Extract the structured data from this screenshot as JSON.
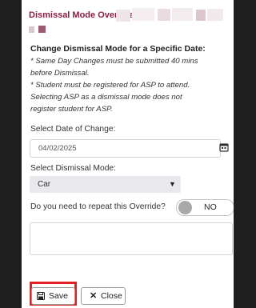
{
  "dialog": {
    "title": "Dismissal Mode Override"
  },
  "instructions": {
    "heading": "Change Dismissal Mode for a Specific Date:",
    "lines": [
      "* Same Day Changes must be submitted 40 mins",
      "before Dismissal.",
      "* Student must be registered for ASP to attend.",
      "Selecting ASP as a dismissal mode does not",
      "register student for ASP."
    ]
  },
  "date_field": {
    "label": "Select Date of Change:",
    "value": "04/02/2025",
    "icon": "calendar-icon"
  },
  "mode_field": {
    "label": "Select Dismissal Mode:",
    "value": "Car"
  },
  "repeat": {
    "question": "Do you need to repeat this Override?",
    "toggle_value": "NO"
  },
  "buttons": {
    "save": "Save",
    "close": "Close"
  },
  "colors": {
    "title": "#8b1d43",
    "highlight": "#e52020",
    "select_bg": "#e9e9ed"
  }
}
